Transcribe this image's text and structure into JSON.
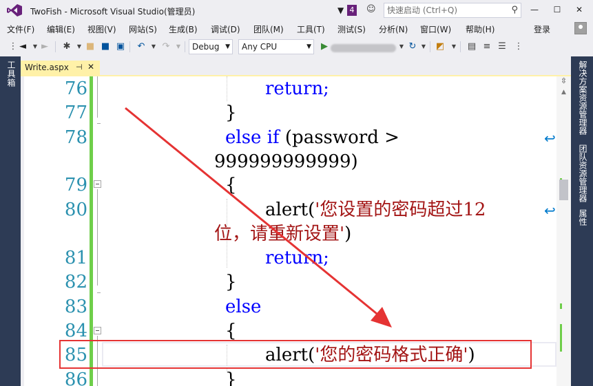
{
  "window": {
    "title": "TwoFish - Microsoft Visual Studio(管理员)",
    "notification_count": "4",
    "quick_launch_placeholder": "快速启动 (Ctrl+Q)",
    "login_label": "登录"
  },
  "menu": [
    "文件(F)",
    "编辑(E)",
    "视图(V)",
    "网站(S)",
    "生成(B)",
    "调试(D)",
    "团队(M)",
    "工具(T)",
    "测试(S)",
    "分析(N)",
    "窗口(W)",
    "帮助(H)"
  ],
  "toolbar": {
    "config": "Debug",
    "platform": "Any CPU"
  },
  "panels": {
    "left": "工具箱",
    "right": [
      "解决方案资源管理器",
      "团队资源管理器",
      "属性"
    ]
  },
  "tab": {
    "name": "Write.aspx",
    "pin": "⊣",
    "close": "✕"
  },
  "code": {
    "lines": [
      {
        "no": "76",
        "text": "return;"
      },
      {
        "no": "77",
        "text": "}"
      },
      {
        "no": "78",
        "kw": "else if",
        "text": " (password >"
      },
      {
        "no": "",
        "text": "999999999999)"
      },
      {
        "no": "79",
        "text": "{"
      },
      {
        "no": "80",
        "fn": "alert(",
        "str": "'您设置的密码超过12"
      },
      {
        "no": "",
        "str": "位，请重新设置'",
        "text": ")"
      },
      {
        "no": "81",
        "text": "return;"
      },
      {
        "no": "82",
        "text": "}"
      },
      {
        "no": "83",
        "kw": "else",
        "text": ""
      },
      {
        "no": "84",
        "text": "{"
      },
      {
        "no": "85",
        "fn": "alert(",
        "str": "'您的密码格式正确'",
        "text": ")"
      },
      {
        "no": "86",
        "text": "}"
      }
    ]
  },
  "colors": {
    "accent": "#68217a",
    "panel": "#2d3b55",
    "tab": "#fff1a8",
    "keyword": "#0000ff",
    "string": "#a31515",
    "line_number": "#2b91af",
    "annotation": "#e53333"
  }
}
